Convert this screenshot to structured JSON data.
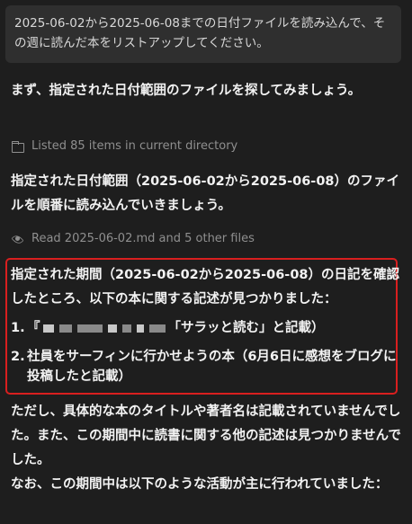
{
  "conversation": {
    "user_message": "2025-06-02から2025-06-08までの日付ファイルを読み込んで、その週に読んだ本をリストアップしてください。",
    "intro": "まず、指定された日付範囲のファイルを探してみましょう。",
    "tool_list": {
      "icon": "folder-icon",
      "text": "Listed 85 items in current directory"
    },
    "reading_plan": "指定された日付範囲（2025-06-02から2025-06-08）のファイルを順番に読み込んでいきましょう。",
    "tool_read": {
      "icon": "eye-icon",
      "text": "Read 2025-06-02.md and 5 other files"
    },
    "finding": "指定された期間（2025-06-02から2025-06-08）の日記を確認したところ、以下の本に関する記述が見つかりました：",
    "books": [
      {
        "num": "1.",
        "prefix": "『",
        "text": "「サラッと読む」と記載）"
      },
      {
        "num": "2.",
        "text": "社員をサーフィンに行かせようの本（6月6日に感想をブログに投稿したと記載）"
      }
    ],
    "note": "ただし、具体的な本のタイトルや著者名は記載されていませんでした。また、この期間中に読書に関する他の記述は見つかりませんでした。",
    "activities_intro": "なお、この期間中は以下のような活動が主に行われていました：",
    "accent_color": "#d91f1f"
  }
}
